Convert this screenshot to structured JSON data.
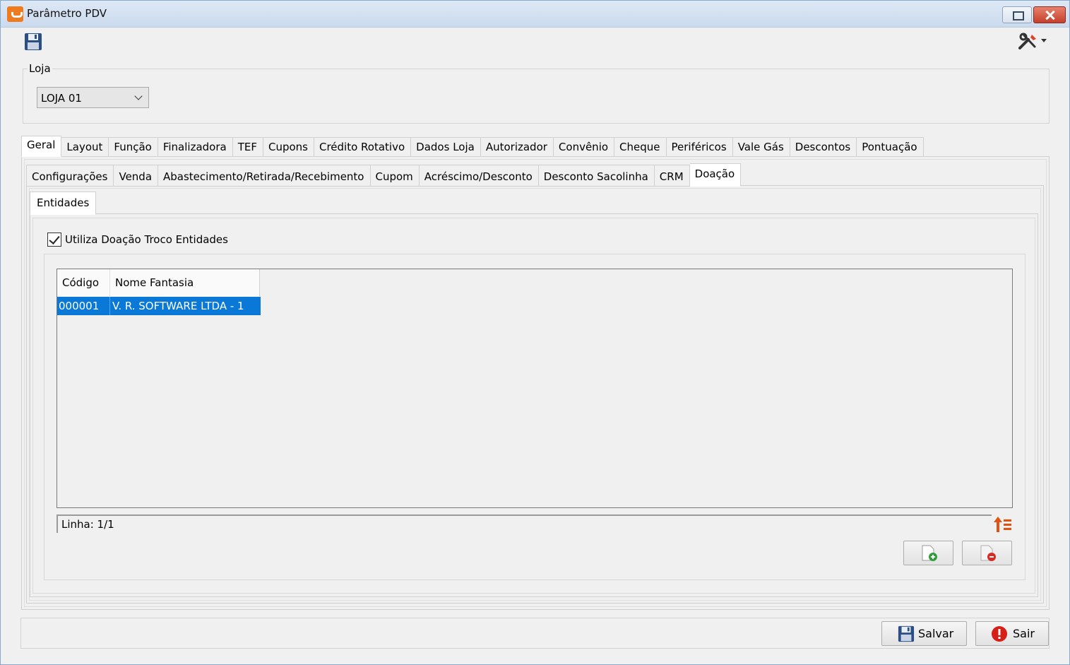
{
  "window": {
    "title": "Parâmetro PDV"
  },
  "loja": {
    "label": "Loja",
    "selected": "LOJA 01"
  },
  "main_tabs": [
    {
      "label": "Geral"
    },
    {
      "label": "Layout"
    },
    {
      "label": "Função"
    },
    {
      "label": "Finalizadora"
    },
    {
      "label": "TEF"
    },
    {
      "label": "Cupons"
    },
    {
      "label": "Crédito Rotativo"
    },
    {
      "label": "Dados Loja"
    },
    {
      "label": "Autorizador"
    },
    {
      "label": "Convênio"
    },
    {
      "label": "Cheque"
    },
    {
      "label": "Periféricos"
    },
    {
      "label": "Vale Gás"
    },
    {
      "label": "Descontos"
    },
    {
      "label": "Pontuação"
    }
  ],
  "sub_tabs": [
    {
      "label": "Configurações"
    },
    {
      "label": "Venda"
    },
    {
      "label": "Abastecimento/Retirada/Recebimento"
    },
    {
      "label": "Cupom"
    },
    {
      "label": "Acréscimo/Desconto"
    },
    {
      "label": "Desconto Sacolinha"
    },
    {
      "label": "CRM"
    },
    {
      "label": "Doação"
    }
  ],
  "third_tabs": [
    {
      "label": "Entidades"
    }
  ],
  "doacao": {
    "checkbox_label": "Utiliza Doação Troco Entidades",
    "checked": true
  },
  "table": {
    "columns": [
      "Código",
      "Nome Fantasia"
    ],
    "rows": [
      [
        "000001",
        "V. R. SOFTWARE LTDA - 1"
      ]
    ],
    "status": "Linha: 1/1"
  },
  "footer": {
    "save_label": "Salvar",
    "exit_label": "Sair"
  },
  "icons": {
    "app": "app-icon",
    "save": "floppy-disk-icon",
    "tools": "tools-icon",
    "sort": "sort-icon",
    "add": "add-document-icon",
    "remove": "remove-document-icon",
    "exit": "exit-icon"
  }
}
